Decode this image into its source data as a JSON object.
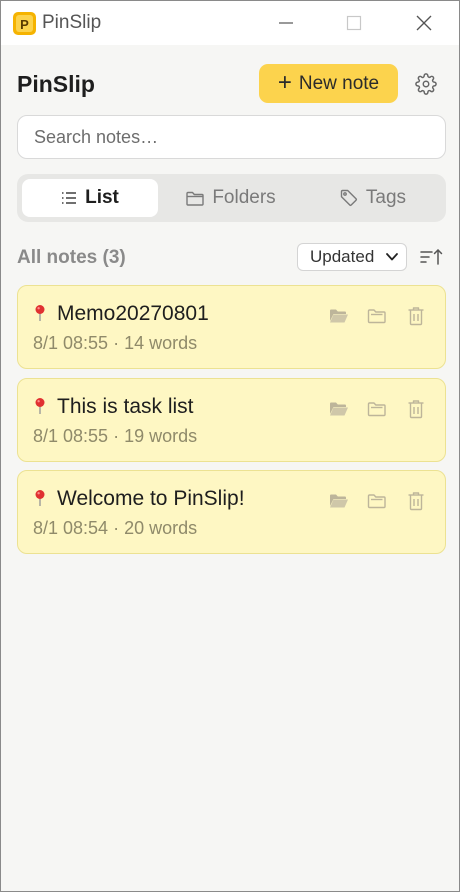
{
  "window": {
    "title": "PinSlip"
  },
  "header": {
    "app_title": "PinSlip",
    "new_note_label": "New note"
  },
  "search": {
    "placeholder": "Search notes…",
    "value": ""
  },
  "tabs": [
    {
      "label": "List",
      "icon": "list-icon",
      "active": true
    },
    {
      "label": "Folders",
      "icon": "folder-icon",
      "active": false
    },
    {
      "label": "Tags",
      "icon": "tag-icon",
      "active": false
    }
  ],
  "list": {
    "title": "All notes (3)",
    "sort_value": "Updated",
    "notes": [
      {
        "title": "Memo20270801",
        "meta": "8/1 08:55 · 14 words",
        "pinned": true
      },
      {
        "title": "This is task list",
        "meta": "8/1 08:55 · 19 words",
        "pinned": true
      },
      {
        "title": "Welcome to PinSlip!",
        "meta": "8/1 08:54 · 20 words",
        "pinned": true
      }
    ]
  },
  "colors": {
    "accent": "#fcd34d",
    "card_background": "#fef7c3",
    "card_border": "#ece292",
    "pin": "#e03131"
  }
}
